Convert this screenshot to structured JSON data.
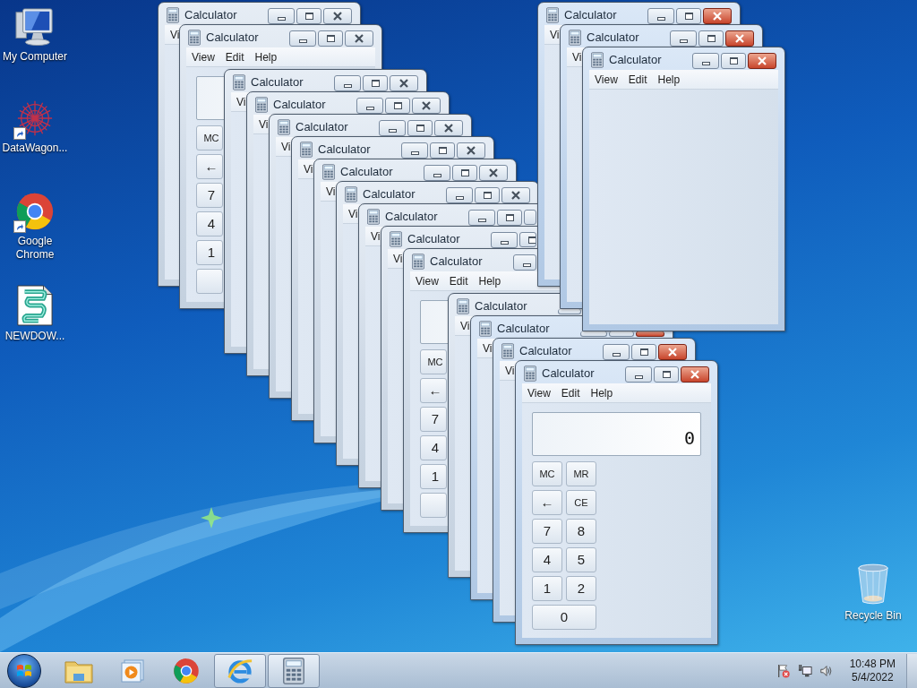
{
  "desktop_icons": [
    {
      "kind": "computer",
      "label": "My Computer",
      "shortcut": false
    },
    {
      "kind": "datawagon",
      "label": "DataWagon...",
      "shortcut": true
    },
    {
      "kind": "chrome",
      "label": "Google Chrome",
      "shortcut": true
    },
    {
      "kind": "script",
      "label": "NEWDOW...",
      "shortcut": false
    },
    {
      "kind": "recycle",
      "label": "Recycle Bin",
      "shortcut": false
    }
  ],
  "windows": [
    {
      "title": "Calculator",
      "menu": [
        "Vi"
      ],
      "active": false
    },
    {
      "title": "Calculator",
      "menu": [
        "View",
        "Edit",
        "Help"
      ],
      "active": false,
      "keys": [
        [
          {
            "kind": "key",
            "label": "MC"
          }
        ],
        [
          {
            "kind": "key",
            "label": "←"
          }
        ],
        [
          {
            "kind": "key",
            "label": "7"
          }
        ],
        [
          {
            "kind": "key",
            "label": "4"
          }
        ],
        [
          {
            "kind": "key",
            "label": "1"
          }
        ],
        [
          {
            "kind": "wide"
          }
        ]
      ]
    },
    {
      "title": "Calculator",
      "menu": [
        "Vi"
      ],
      "active": false
    },
    {
      "title": "Calculator",
      "menu": [
        "Vi"
      ],
      "active": false
    },
    {
      "title": "Calculator",
      "menu": [
        "Vi"
      ],
      "active": false
    },
    {
      "title": "Calculator",
      "menu": [
        "Vi"
      ],
      "active": false
    },
    {
      "title": "Calculator",
      "menu": [
        "Vi"
      ],
      "active": false
    },
    {
      "title": "Calculator",
      "menu": [
        "Vi"
      ],
      "active": false
    },
    {
      "title": "Calculator",
      "menu": [
        "Vi"
      ],
      "active": false
    },
    {
      "title": "Calculator",
      "menu": [
        "Vi"
      ],
      "active": false
    },
    {
      "title": "Calculator",
      "menu": [
        "View",
        "Edit",
        "Help"
      ],
      "active": false,
      "keys": [
        [
          {
            "kind": "key",
            "label": "MC"
          }
        ],
        [
          {
            "kind": "key",
            "label": "←"
          }
        ],
        [
          {
            "kind": "key",
            "label": "7"
          }
        ],
        [
          {
            "kind": "key",
            "label": "4"
          }
        ],
        [
          {
            "kind": "key",
            "label": "1"
          }
        ],
        [
          {
            "kind": "wide"
          }
        ]
      ]
    },
    {
      "title": "Calculator",
      "menu": [
        "Vi"
      ],
      "active": false
    },
    {
      "title": "Calculator",
      "menu": [
        "Vi"
      ],
      "active": true
    },
    {
      "title": "Calculator",
      "menu": [
        "Vi"
      ],
      "active": true
    },
    {
      "title": "Calculator",
      "menu": [
        "Vi"
      ],
      "active": true
    },
    {
      "title": "Calculator",
      "menu": [
        "View",
        "Edit",
        "Help"
      ],
      "active": true
    },
    {
      "title": "Calculator",
      "menu": [
        "Vi"
      ],
      "active": true
    },
    {
      "title": "Calculator",
      "menu": [
        "View",
        "Edit",
        "Help"
      ],
      "active": true,
      "display": "0",
      "keys": [
        [
          {
            "kind": "key",
            "label": "MC"
          },
          {
            "kind": "key",
            "label": "MR"
          }
        ],
        [
          {
            "kind": "key",
            "label": "←"
          },
          {
            "kind": "key",
            "label": "CE"
          }
        ],
        [
          {
            "kind": "key",
            "label": "7"
          },
          {
            "kind": "key",
            "label": "8"
          }
        ],
        [
          {
            "kind": "key",
            "label": "4"
          },
          {
            "kind": "key",
            "label": "5"
          }
        ],
        [
          {
            "kind": "key",
            "label": "1"
          },
          {
            "kind": "key",
            "label": "2"
          }
        ],
        [
          {
            "kind": "wide",
            "label": "0"
          }
        ]
      ]
    }
  ],
  "taskbar": {
    "items": [
      {
        "kind": "explorer",
        "running": false
      },
      {
        "kind": "media",
        "running": false
      },
      {
        "kind": "chrome",
        "running": false
      },
      {
        "kind": "ie",
        "running": true
      },
      {
        "kind": "calculator",
        "running": true
      }
    ],
    "clock": {
      "time": "10:48 PM",
      "date": "5/4/2022"
    }
  }
}
